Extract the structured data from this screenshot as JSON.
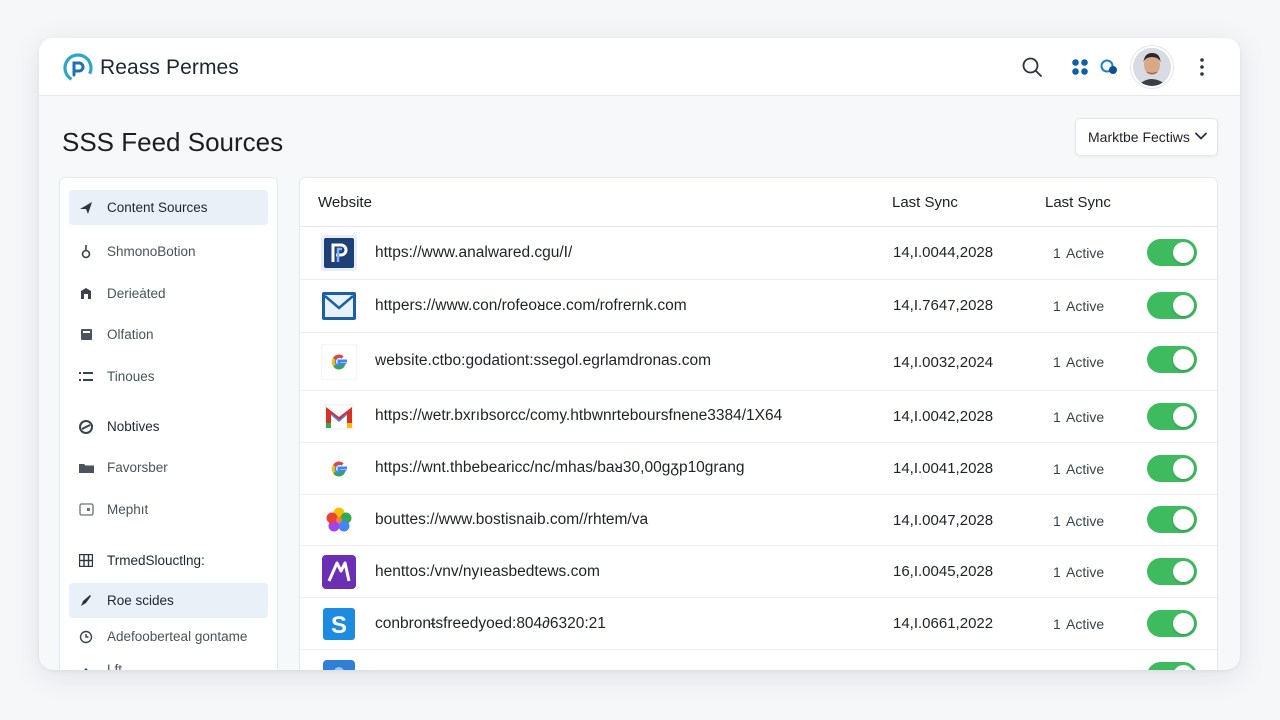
{
  "header": {
    "app_name": "Reass Permes",
    "icons": [
      "brand-logo-icon",
      "search-icon",
      "apps-grid-icon",
      "notification-icon",
      "avatar",
      "more-vertical-icon"
    ]
  },
  "page": {
    "title": "SSS Feed Sources",
    "filter_label": "Marktbe Fectiws"
  },
  "sidebar": {
    "items": [
      {
        "label": "Content Sources",
        "icon": "plane-icon"
      },
      {
        "label": "ShmonoBotion",
        "icon": "pin-icon"
      },
      {
        "label": "Derieȧted",
        "icon": "box-icon"
      },
      {
        "label": "Olfation",
        "icon": "square-icon"
      },
      {
        "label": "Tinoues",
        "icon": "list-icon"
      },
      {
        "label": "Nobtives",
        "icon": "refresh-icon"
      },
      {
        "label": "Favorsber",
        "icon": "folder-icon"
      },
      {
        "label": "Mephıt",
        "icon": "tag-icon"
      },
      {
        "label": "TrmedSlouctlng:",
        "icon": "grid-icon"
      },
      {
        "label": "Roe scides",
        "icon": "rocket-icon"
      },
      {
        "label": "Adefooberteal ɡontame",
        "icon": "clock-icon"
      },
      {
        "label": "Lft",
        "icon": "dot-icon"
      }
    ]
  },
  "table": {
    "headers": [
      "Website",
      "Last Sync",
      "Last Sync"
    ],
    "rows": [
      {
        "url": "https://www.analwared.cgu/I/",
        "date": "14,I.0044,2028",
        "num": "1",
        "status": "Active",
        "logo": "p-logo-icon"
      },
      {
        "url": "httpers://www.con/rofeoᴚce.com/rofrernk.com",
        "date": "14,I.7647,2028",
        "num": "1",
        "status": "Active",
        "logo": "mail-logo-icon"
      },
      {
        "url": "website.ctbo:godationt:ssegol.egrlamdronas.com",
        "date": "14,I.0032,2024",
        "num": "1",
        "status": "Active",
        "logo": "google-logo-icon"
      },
      {
        "url": "https://wetr.bxrıbsorcc/comy.htbwnrteboursfnene3384/1X64",
        "date": "14,I.0042,2028",
        "num": "1",
        "status": "Active",
        "logo": "gmail-logo-icon"
      },
      {
        "url": "https://wnt.thbebearicc/nc/mhas/baᴚ30,00ɡᵹp10grang",
        "date": "14,I.0041,2028",
        "num": "1",
        "status": "Active",
        "logo": "google-logo-icon"
      },
      {
        "url": "bouttes://www.bostisnaib.com//rhtem/va",
        "date": "14,I.0047,2028",
        "num": "1",
        "status": "Active",
        "logo": "photos-logo-icon"
      },
      {
        "url": "henttos:/vnv/nyıeasbedtews.com",
        "date": "16,I.0045,2028",
        "num": "1",
        "status": "Active",
        "logo": "purple-logo-icon"
      },
      {
        "url": "conbronᵵsfreedyoed:804∂6320:21",
        "date": "14,I.0661,2022",
        "num": "1",
        "status": "Active",
        "logo": "s-logo-icon"
      },
      {
        "url": "",
        "date": "",
        "num": "",
        "status": "",
        "logo": "blue-logo-icon"
      }
    ]
  },
  "colors": {
    "toggle_on": "#3dbb5e",
    "accent": "#1a73e8",
    "active_sidebar": "#eaf0f8"
  }
}
